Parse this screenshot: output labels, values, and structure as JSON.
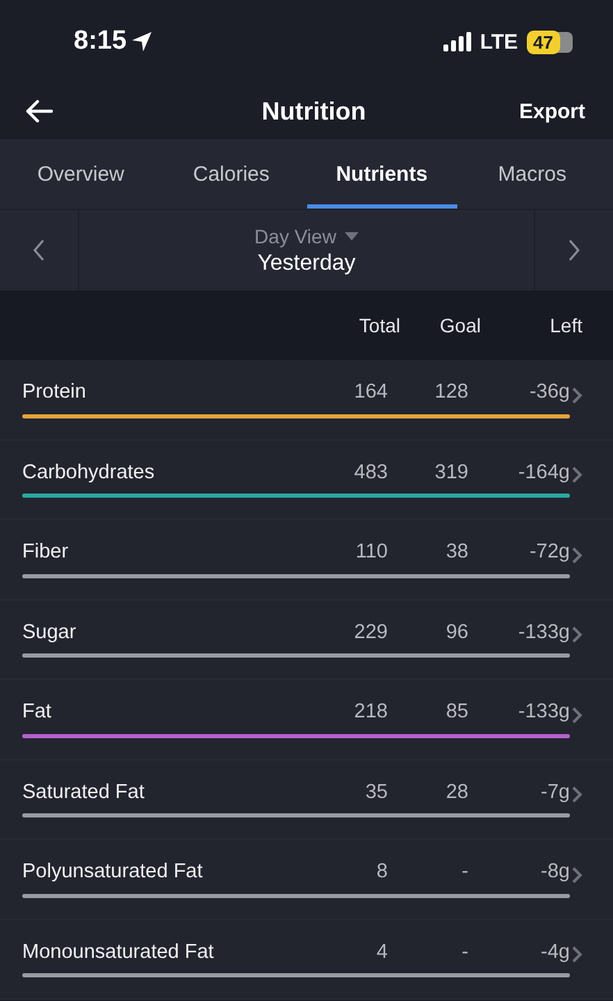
{
  "status_bar": {
    "time": "8:15",
    "network": "LTE",
    "battery": "47"
  },
  "header": {
    "title": "Nutrition",
    "action": "Export"
  },
  "tabs": [
    {
      "label": "Overview",
      "selected": false
    },
    {
      "label": "Calories",
      "selected": false
    },
    {
      "label": "Nutrients",
      "selected": true
    },
    {
      "label": "Macros",
      "selected": false
    }
  ],
  "date_nav": {
    "view": "Day View",
    "date": "Yesterday"
  },
  "table": {
    "columns": [
      "Total",
      "Goal",
      "Left"
    ],
    "rows": [
      {
        "name": "Protein",
        "total": "164",
        "goal": "128",
        "left": "-36g",
        "level": 1,
        "color": "#e6a33e"
      },
      {
        "name": "Carbohydrates",
        "total": "483",
        "goal": "319",
        "left": "-164g",
        "level": 1,
        "color": "#2aa9a3"
      },
      {
        "name": "Fiber",
        "total": "110",
        "goal": "38",
        "left": "-72g",
        "level": 1,
        "color": "#9a9ba2"
      },
      {
        "name": "Sugar",
        "total": "229",
        "goal": "96",
        "left": "-133g",
        "level": 1,
        "color": "#9a9ba2"
      },
      {
        "name": "Fat",
        "total": "218",
        "goal": "85",
        "left": "-133g",
        "level": 1,
        "color": "#b55fd0"
      },
      {
        "name": "Saturated Fat",
        "total": "35",
        "goal": "28",
        "left": "-7g",
        "level": 1,
        "color": "#9a9ba2"
      },
      {
        "name": "Polyunsaturated Fat",
        "total": "8",
        "goal": "-",
        "left": "-8g",
        "level": 1,
        "color": "#9a9ba2"
      },
      {
        "name": "Monounsaturated Fat",
        "total": "4",
        "goal": "-",
        "left": "-4g",
        "level": 1,
        "color": "#9a9ba2"
      }
    ]
  }
}
